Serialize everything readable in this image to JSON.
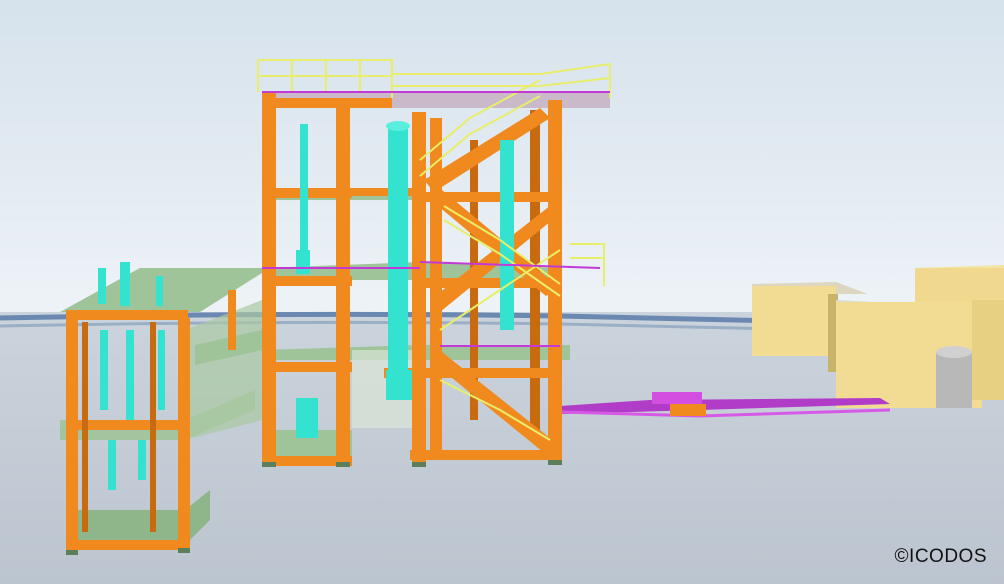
{
  "watermark": {
    "text": "©ICODOS"
  },
  "palette": {
    "sky_top": "#d8e4ee",
    "sky_bottom": "#eef3f7",
    "ground": "#c3ccd6",
    "beam": "#f08a1e",
    "beam_dark": "#c86a10",
    "floor": "#9fc49a",
    "equipment": "#33e3cf",
    "pipe": "#c43ad6",
    "railing": "#e8ee6a",
    "building": "#f1dc92",
    "building_shade": "#c9b36a"
  }
}
